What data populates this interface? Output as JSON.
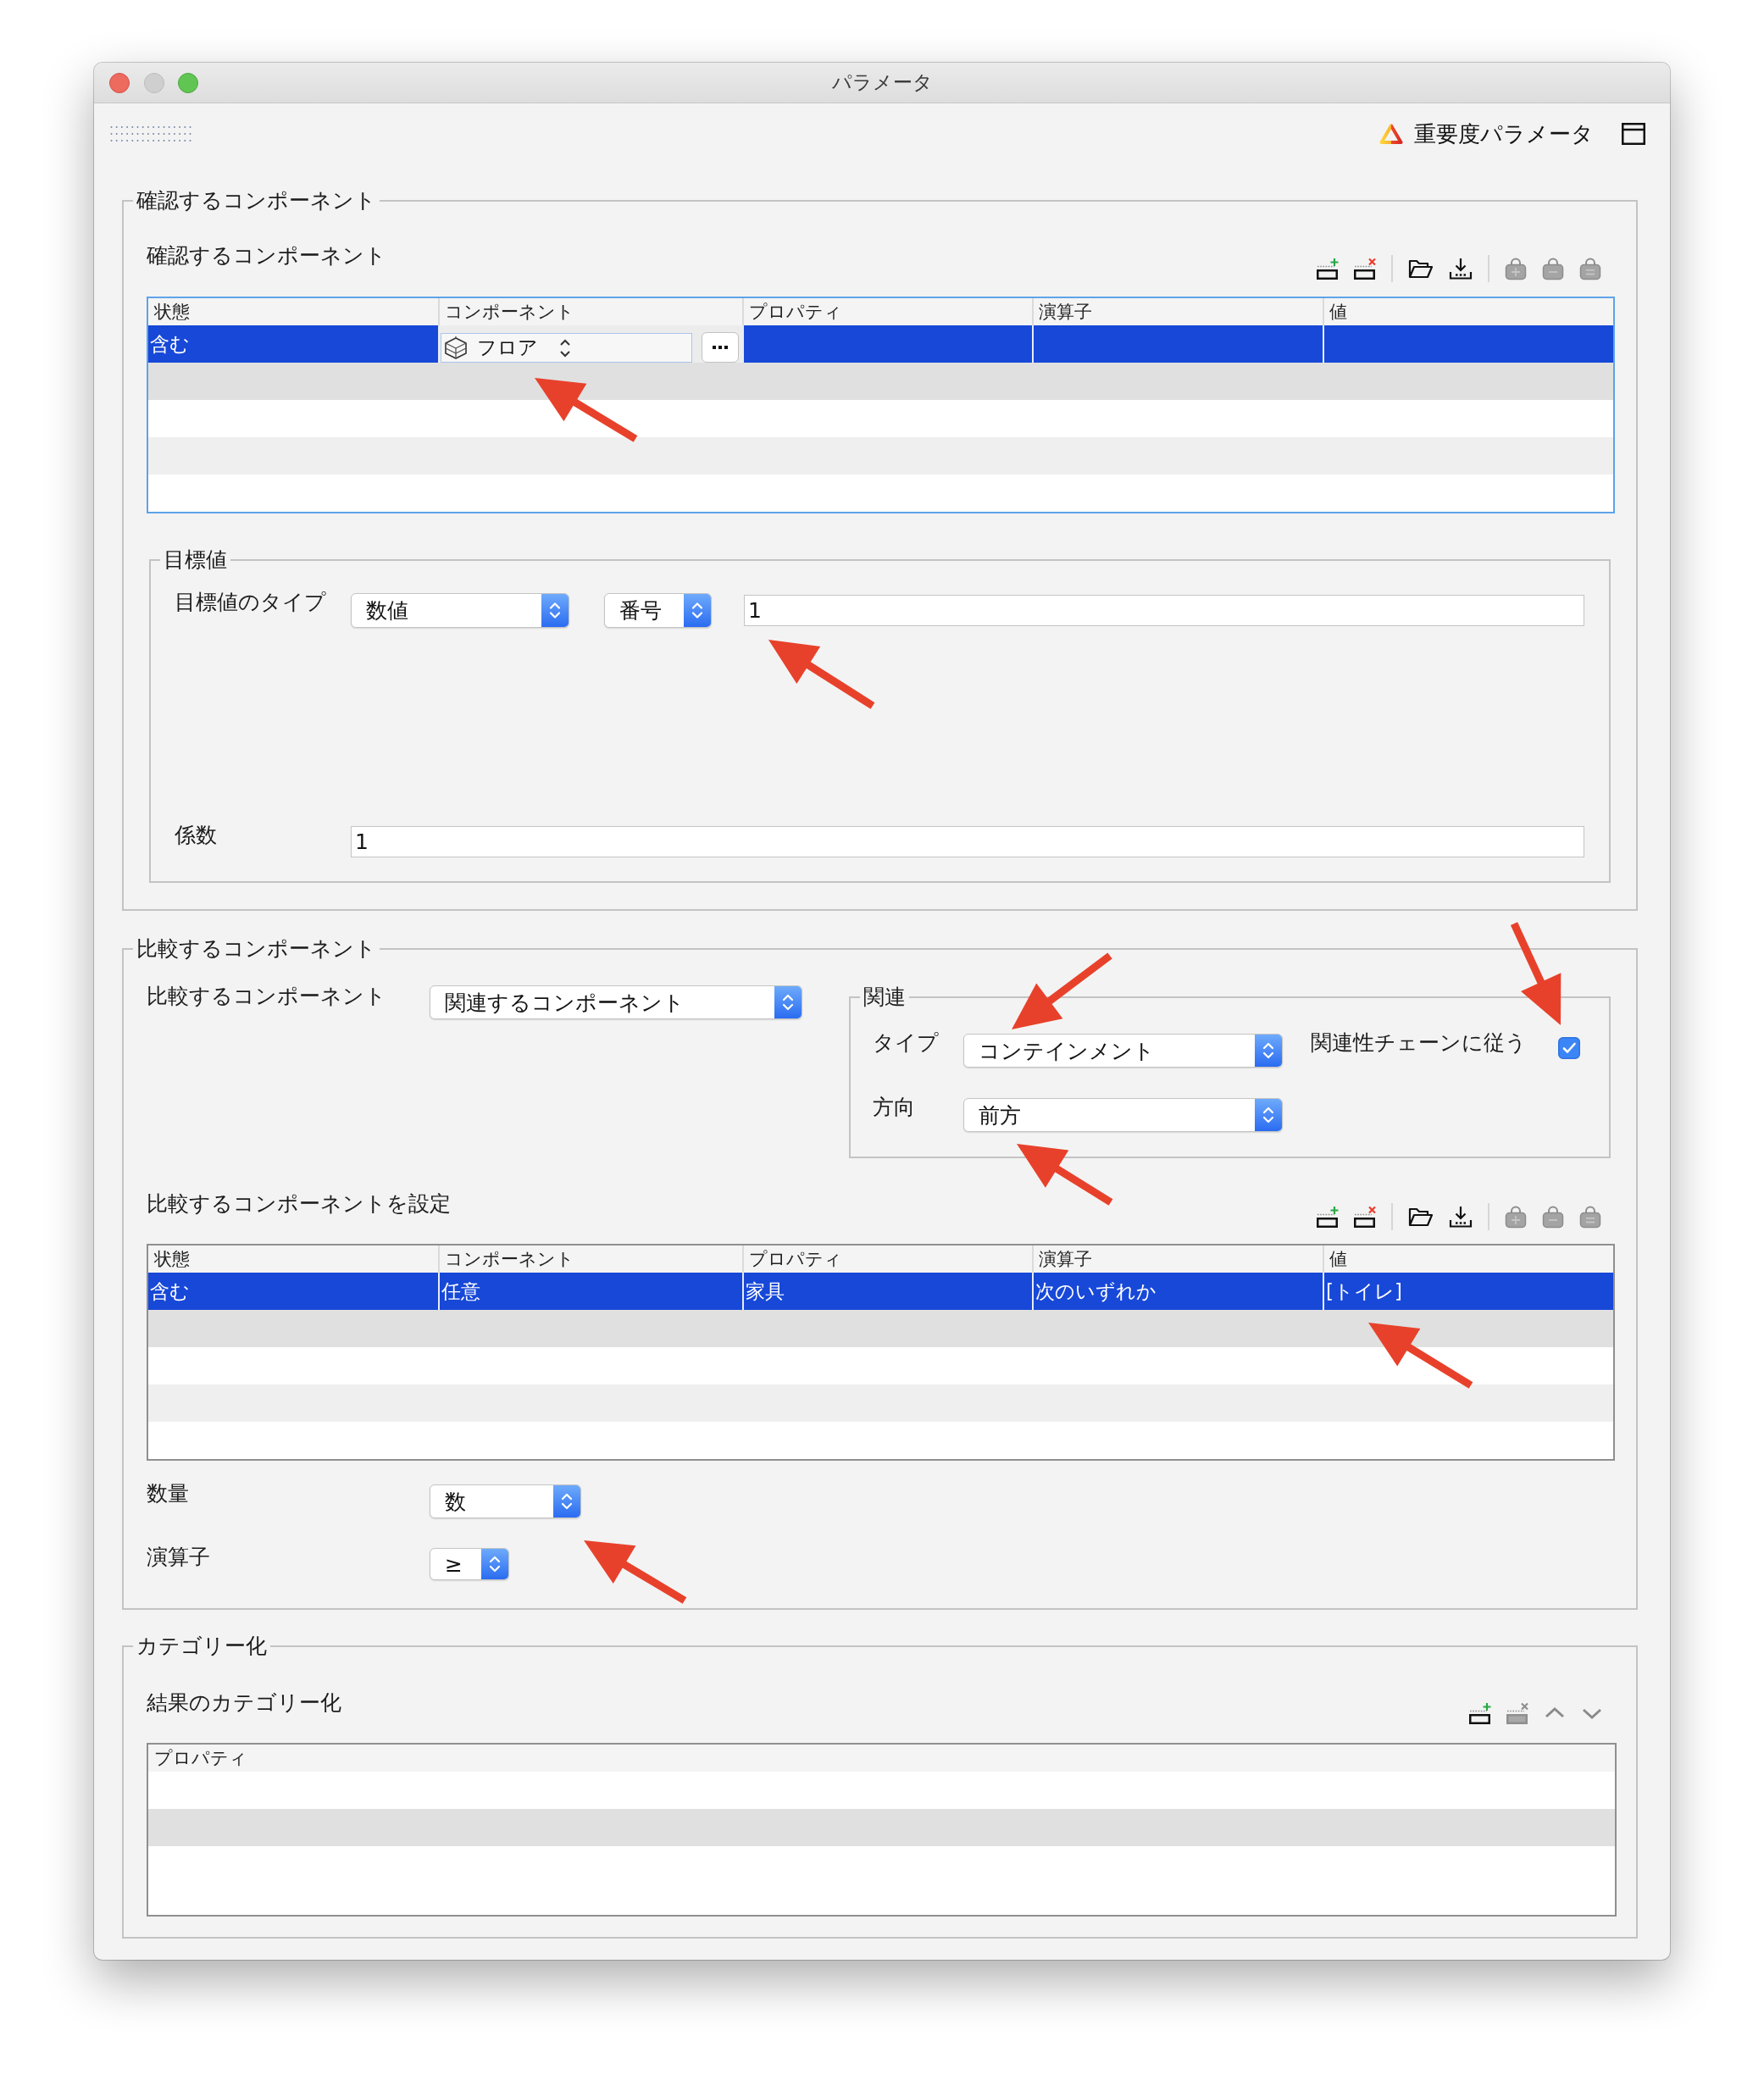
{
  "window": {
    "title": "パラメータ",
    "controls": [
      {
        "kind": "close",
        "disabled": false
      },
      {
        "kind": "minimize",
        "disabled": true
      },
      {
        "kind": "zoom",
        "disabled": false
      }
    ]
  },
  "toolbar": {
    "importance_button": "重要度パラメータ"
  },
  "check_section": {
    "legend": "確認するコンポーネント",
    "title": "確認するコンポーネント",
    "tools": [
      {
        "kind": "add_row",
        "disabled": false
      },
      {
        "kind": "delete_row",
        "disabled": false
      },
      {
        "kind": "separator"
      },
      {
        "kind": "folder",
        "disabled": false
      },
      {
        "kind": "download",
        "disabled": false
      },
      {
        "kind": "separator"
      },
      {
        "kind": "bag_plus",
        "disabled": true
      },
      {
        "kind": "bag_minus",
        "disabled": true
      },
      {
        "kind": "bag_equals",
        "disabled": true
      }
    ],
    "table": {
      "focused": true,
      "columns": [
        "状態",
        "コンポーネント",
        "プロパティ",
        "演算子",
        "値"
      ],
      "rows": [
        {
          "selected": true,
          "cells": [
            {
              "kind": "text",
              "text": "含む"
            },
            {
              "kind": "combo",
              "text": "フロア"
            },
            {
              "kind": "blank"
            },
            {
              "kind": "blank"
            },
            {
              "kind": "blank"
            }
          ]
        }
      ]
    },
    "target": {
      "legend": "目標値",
      "type_label": "目標値のタイプ",
      "type_popup": "数値",
      "unit_popup": "番号",
      "value_field": "1",
      "factor_label": "係数",
      "factor_field": "1"
    }
  },
  "compare_section": {
    "legend": "比較するコンポーネント",
    "component_label": "比較するコンポーネント",
    "component_popup": "関連するコンポーネント",
    "relation": {
      "legend": "関連",
      "type_label": "タイプ",
      "type_popup": "コンテインメント",
      "chain_label": "関連性チェーンに従う",
      "chain_checked": true,
      "direction_label": "方向",
      "direction_popup": "前方"
    },
    "title": "比較するコンポーネントを設定",
    "tools": [
      {
        "kind": "add_row",
        "disabled": false
      },
      {
        "kind": "delete_row",
        "disabled": false
      },
      {
        "kind": "separator"
      },
      {
        "kind": "folder",
        "disabled": false
      },
      {
        "kind": "download",
        "disabled": false
      },
      {
        "kind": "separator"
      },
      {
        "kind": "bag_plus",
        "disabled": true
      },
      {
        "kind": "bag_minus",
        "disabled": true
      },
      {
        "kind": "bag_equals",
        "disabled": true
      }
    ],
    "table": {
      "focused": false,
      "columns": [
        "状態",
        "コンポーネント",
        "プロパティ",
        "演算子",
        "値"
      ],
      "rows": [
        {
          "selected": true,
          "cells": [
            {
              "kind": "text",
              "text": "含む"
            },
            {
              "kind": "text",
              "text": "任意"
            },
            {
              "kind": "text",
              "text": "家具"
            },
            {
              "kind": "text",
              "text": "次のいずれか"
            },
            {
              "kind": "text",
              "text": "[トイレ]"
            }
          ]
        }
      ]
    },
    "quantity_label": "数量",
    "quantity_popup": "数",
    "operator_label": "演算子",
    "operator_popup": "≥"
  },
  "category_section": {
    "legend": "カテゴリー化",
    "title": "結果のカテゴリー化",
    "tools": [
      {
        "kind": "add_row",
        "disabled": false
      },
      {
        "kind": "delete_row",
        "disabled": true
      },
      {
        "kind": "up",
        "disabled": true
      },
      {
        "kind": "down",
        "disabled": true
      }
    ],
    "table": {
      "focused": false,
      "columns": [
        "プロパティ"
      ]
    }
  }
}
